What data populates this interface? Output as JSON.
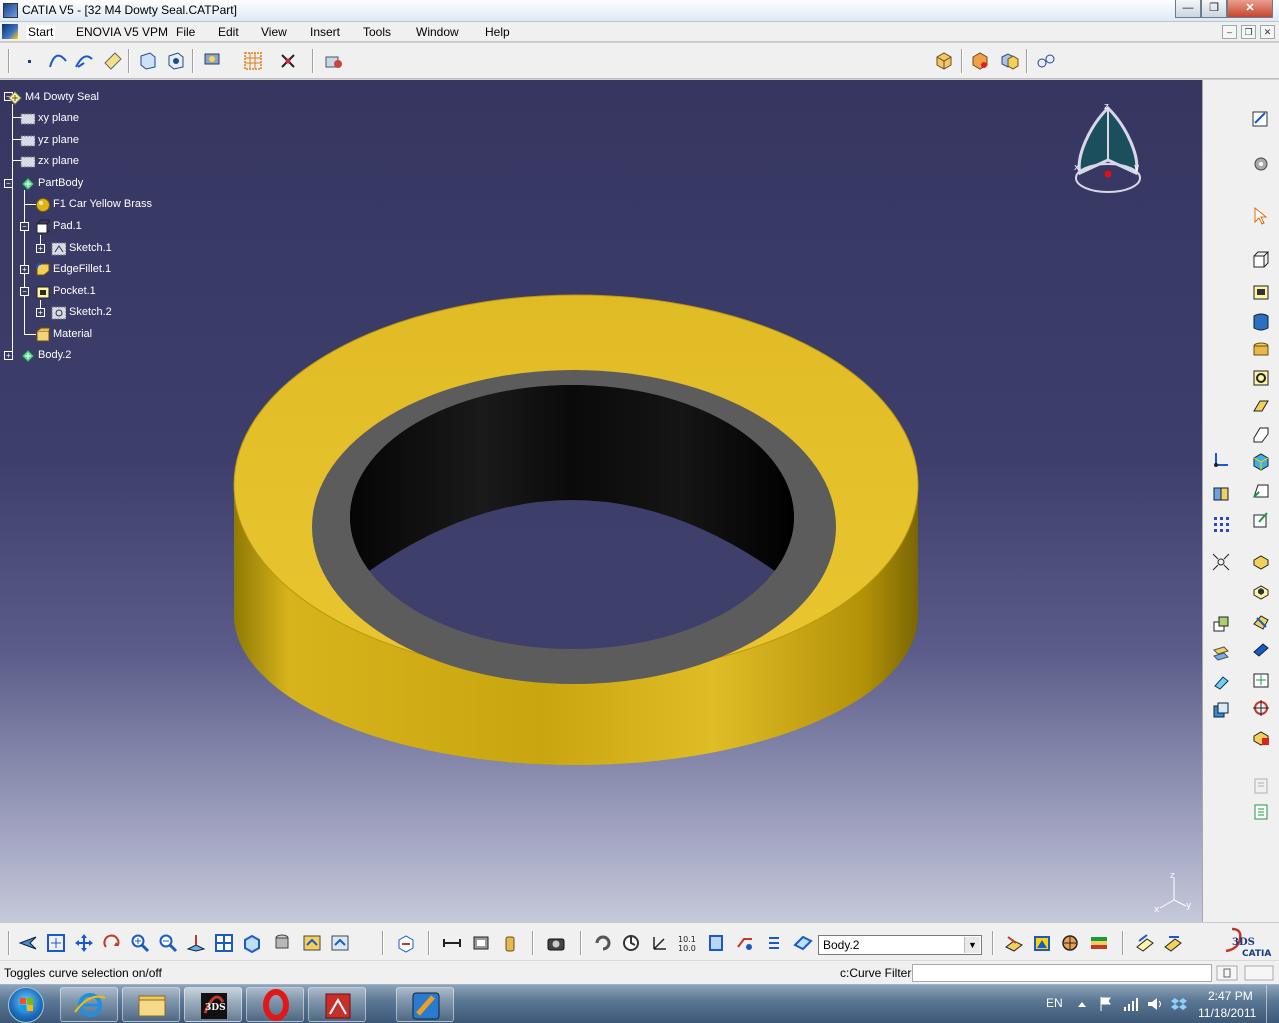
{
  "window": {
    "title": "CATIA V5 - [32 M4 Dowty Seal.CATPart]",
    "controls": {
      "minimize": "—",
      "restore": "❐",
      "close": "✕"
    }
  },
  "menubar": {
    "items": [
      "Start",
      "ENOVIA V5 VPM",
      "File",
      "Edit",
      "View",
      "Insert",
      "Tools",
      "Window",
      "Help"
    ],
    "doc_controls": {
      "minimize": "–",
      "restore": "❐",
      "close": "✕"
    }
  },
  "spec_tree": {
    "nodes": [
      {
        "label": "M4 Dowty Seal",
        "icon": "part-icon"
      },
      {
        "label": "xy plane",
        "icon": "plane-icon"
      },
      {
        "label": "yz plane",
        "icon": "plane-icon"
      },
      {
        "label": "zx plane",
        "icon": "plane-icon"
      },
      {
        "label": "PartBody",
        "icon": "body-icon"
      },
      {
        "label": "F1 Car Yellow Brass",
        "icon": "material-sphere-icon"
      },
      {
        "label": "Pad.1",
        "icon": "pad-icon"
      },
      {
        "label": "Sketch.1",
        "icon": "sketch-icon"
      },
      {
        "label": "EdgeFillet.1",
        "icon": "fillet-icon"
      },
      {
        "label": "Pocket.1",
        "icon": "pocket-icon"
      },
      {
        "label": "Sketch.2",
        "icon": "sketch-icon"
      },
      {
        "label": "Material",
        "icon": "material-icon"
      },
      {
        "label": "Body.2",
        "icon": "body-icon"
      }
    ]
  },
  "compass": {
    "labels": [
      "z",
      "x",
      "y"
    ]
  },
  "axis_triad": {
    "labels": [
      "z",
      "x",
      "y"
    ]
  },
  "bottom_toolbar": {
    "body_select": {
      "value": "Body.2",
      "caret": "▼"
    },
    "logo": {
      "main": "CATIA",
      "mark": "3DS"
    }
  },
  "statusbar": {
    "message": "Toggles curve selection on/off",
    "filter_label": "c:Curve Filter",
    "command_value": ""
  },
  "taskbar": {
    "language": "EN",
    "time": "2:47 PM",
    "date": "11/18/2011"
  },
  "colors": {
    "viewport_top": "#363661",
    "viewport_bottom": "#c6c9da",
    "part_yellow": "#e2c02a",
    "part_shadow": "#a98a06",
    "inner_gray": "#5a5a5a",
    "toolbar_bg": "#f0f0f0"
  }
}
